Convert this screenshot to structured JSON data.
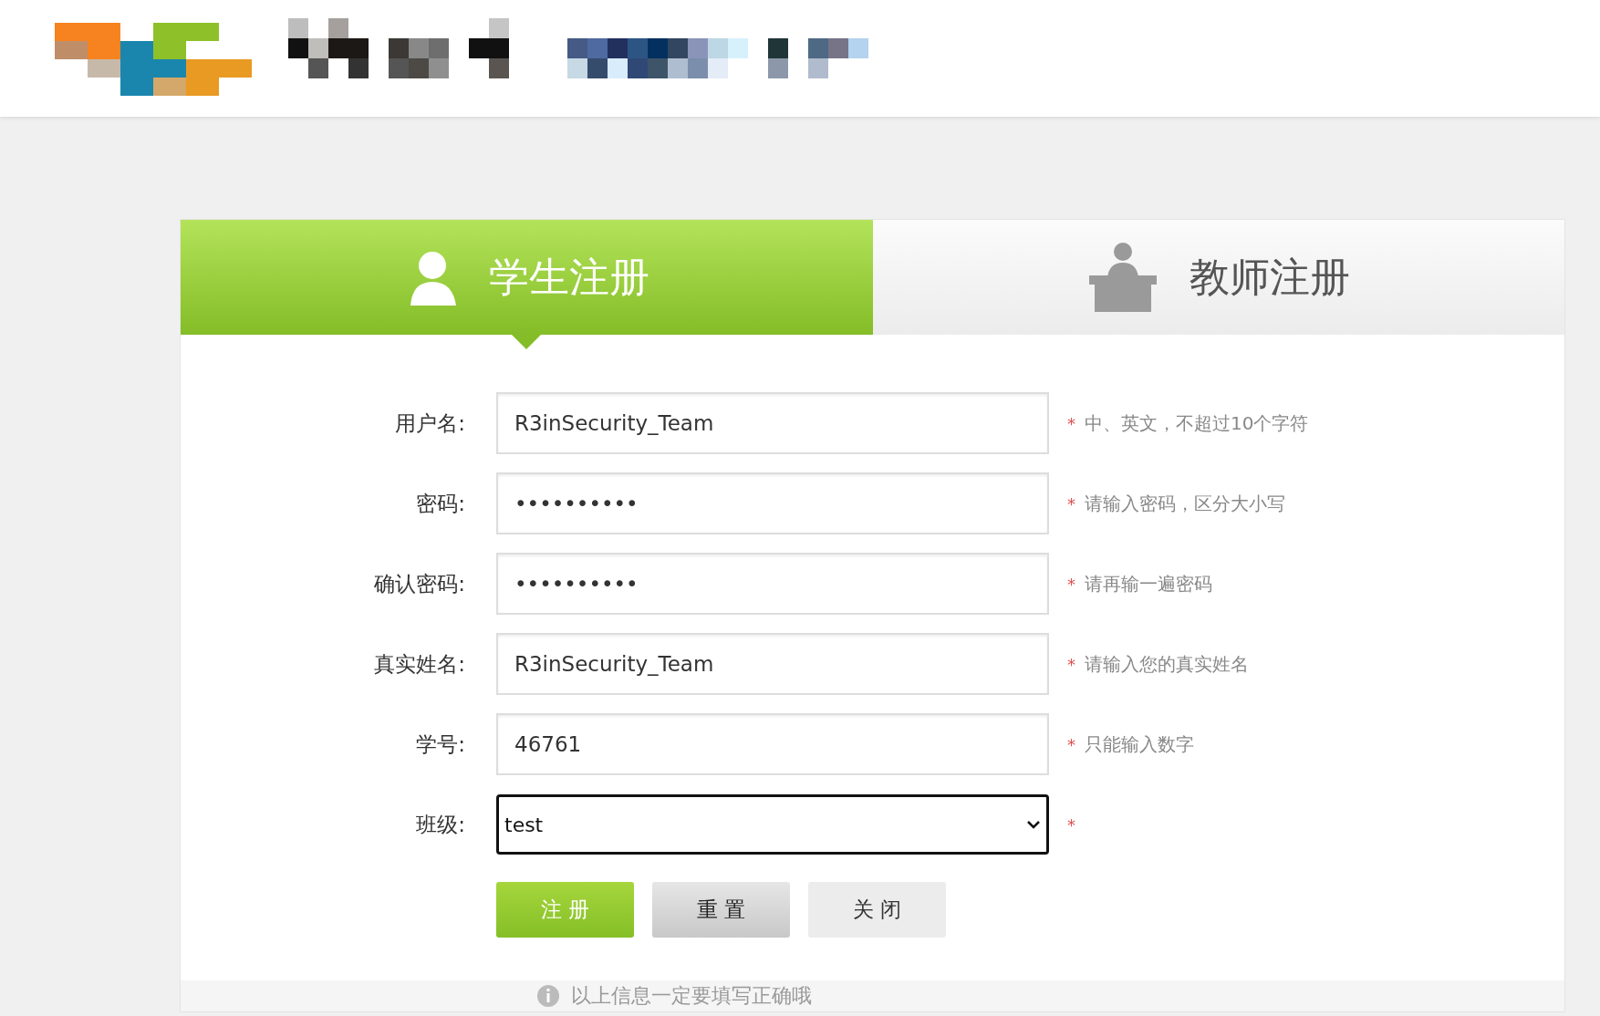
{
  "tabs": [
    {
      "label": "学生注册",
      "selected": true
    },
    {
      "label": "教师注册",
      "selected": false
    }
  ],
  "fields": [
    {
      "kind": "text",
      "label": "用户名:",
      "value": "R3inSecurity_Team",
      "required": "*",
      "hint": "中、英文，不超过10个字符"
    },
    {
      "kind": "text",
      "label": "密码:",
      "value": "••••••••••",
      "required": "*",
      "hint": "请输入密码，区分大小写"
    },
    {
      "kind": "text",
      "label": "确认密码:",
      "value": "••••••••••",
      "required": "*",
      "hint": "请再输一遍密码"
    },
    {
      "kind": "text",
      "label": "真实姓名:",
      "value": "R3inSecurity_Team",
      "required": "*",
      "hint": "请输入您的真实姓名"
    },
    {
      "kind": "text",
      "label": "学号:",
      "value": "46761",
      "required": "*",
      "hint": "只能输入数字"
    },
    {
      "kind": "select",
      "label": "班级:",
      "value": "test",
      "required": "*"
    }
  ],
  "buttons": [
    {
      "kind": "primary",
      "label": "注 册"
    },
    {
      "kind": "secondary",
      "label": "重 置"
    },
    {
      "kind": "plain",
      "label": "关 闭"
    }
  ],
  "footer_note": "以上信息一定要填写正确哦"
}
